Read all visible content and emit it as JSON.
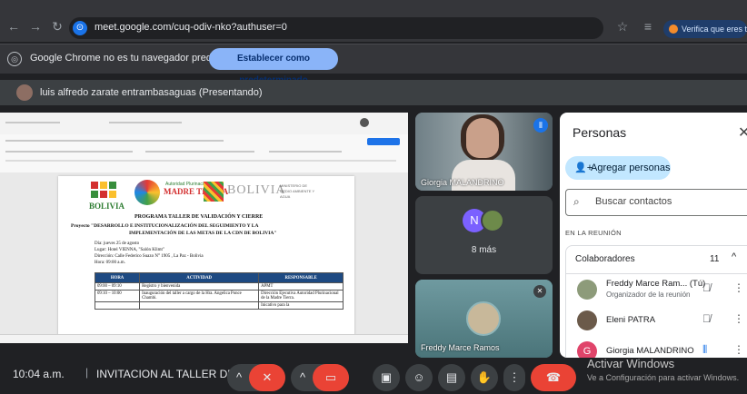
{
  "browser": {
    "url": "meet.google.com/cuq-odiv-nko?authuser=0",
    "verify_label": "Verifica que eres tú",
    "icons": [
      "back-arrow-icon",
      "forward-arrow-icon",
      "reload-icon",
      "star-icon",
      "extensions-icon"
    ]
  },
  "infobar": {
    "message": "Google Chrome no es tu navegador predeterminado",
    "button": "Establecer como predeterminado"
  },
  "presenter": {
    "label": "luis alfredo zarate entrambasaguas (Presentando)"
  },
  "document": {
    "logo_left_text": "BOLIVIA",
    "logo_madre_small": "Autoridad Plurinacional de la",
    "logo_madre": "MADRE TIERRA",
    "logo_bolivia": "BOLIVIA",
    "logo_ministry": "MINISTERIO DE MEDIO AMBIENTE Y AGUA",
    "title1": "PROGRAMA TALLER DE VALIDACIÓN Y CIERRE",
    "title2": "Proyecto \"DESARROLLO E INSTITUCIONALIZACIÓN DEL SEGUIMIENTO Y LA",
    "title3": "IMPLEMENTACIÓN DE LAS METAS DE LA CDN DE BOLIVIA\"",
    "meta": [
      "Día: jueves 25 de agosto",
      "Lugar: Hotel VIENNA, \"Salón Klimt\"",
      "Dirección: Calle Federico Suazo N° 1905 , La Paz - Bolivia",
      "Hora: 09:00 a.m."
    ],
    "table_headers": [
      "HORA",
      "ACTIVIDAD",
      "RESPONSABLE"
    ],
    "table_rows": [
      [
        "09:00 – 09:10",
        "Registro y bienvenida",
        "APMT"
      ],
      [
        "09:10 – 10:00",
        "Inauguración del taller a cargo de la Hra. Angelica Ponce Chambi.",
        "Dirección Ejecutiva Autoridad Plurinacional de la Madre Tierra."
      ],
      [
        "",
        "",
        "Inicativo para la"
      ]
    ]
  },
  "tiles": {
    "tile1_name": "Giorgia MALANDRINO",
    "tile2_initial": "N",
    "tile2_more": "8 más",
    "tile3_name": "Freddy Marce Ramos"
  },
  "people": {
    "title": "Personas",
    "add_button": "Agregar personas",
    "search_placeholder": "Buscar contactos",
    "section": "EN LA REUNIÓN",
    "group_label": "Colaboradores",
    "group_count": "11",
    "participants": [
      {
        "name": "Freddy Marce Ram...",
        "tag": "(Tú)",
        "sub": "Organizador de la reunión",
        "avatar_color": "#8d9b7a"
      },
      {
        "name": "Eleni PATRA",
        "tag": "",
        "sub": "",
        "avatar_color": "#6b5a4a"
      },
      {
        "name": "Giorgia MALANDRINO",
        "tag": "",
        "sub": "",
        "avatar_color": "#e0446a",
        "initial": "G"
      }
    ]
  },
  "bottom": {
    "time": "10:04 a.m.",
    "separator": "|",
    "meeting_title": "INVITACION AL TALLER DE CIER...",
    "watermark_title": "Activar Windows",
    "watermark_sub": "Ve a Configuración para activar Windows."
  },
  "colors": {
    "accent": "#8ab4f8",
    "end_call": "#ea4335",
    "panel_bg": "#ffffff",
    "meet_bg": "#202124"
  }
}
